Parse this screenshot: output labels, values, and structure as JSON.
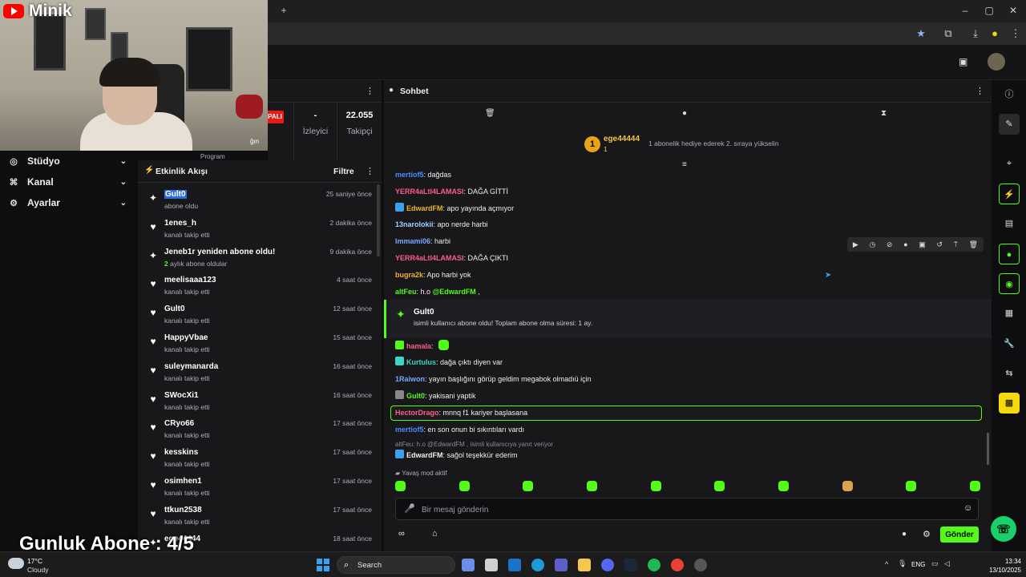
{
  "overlay": {
    "channel_name": "Minik",
    "daily_subs": "Gunluk Abone : 4/5"
  },
  "left_nav": {
    "items": [
      {
        "label": "Stüdyo",
        "icon": "studio-icon"
      },
      {
        "label": "Kanal",
        "icon": "channel-icon"
      },
      {
        "label": "Ayarlar",
        "icon": "gear-icon"
      }
    ]
  },
  "stats": {
    "live_badge": "PALI",
    "program_label": "Program",
    "viewers_value": "-",
    "viewers_label": "İzleyici",
    "followers_value": "22.055",
    "followers_label": "Takipçi",
    "partial_label": "ğın"
  },
  "activity": {
    "title": "Etkinlik Akışı",
    "filter_label": "Filtre",
    "items": [
      {
        "name": "Gult0",
        "sub": "abone oldu",
        "time": "25 saniye önce",
        "icon": "sparkle-icon",
        "highlight": true
      },
      {
        "name": "1enes_h",
        "sub": "kanalı takip etti",
        "time": "2 dakika önce",
        "icon": "heart-icon"
      },
      {
        "name": "Jeneb1r yeniden abone oldu!",
        "sub_prefix": "2",
        "sub": " aylık abone oldular",
        "time": "9 dakika önce",
        "icon": "sparkle-icon"
      },
      {
        "name": "meelisaaa123",
        "sub": "kanalı takip etti",
        "time": "4 saat önce",
        "icon": "heart-icon"
      },
      {
        "name": "Gult0",
        "sub": "kanalı takip etti",
        "time": "12 saat önce",
        "icon": "heart-icon"
      },
      {
        "name": "HappyVbae",
        "sub": "kanalı takip etti",
        "time": "15 saat önce",
        "icon": "heart-icon"
      },
      {
        "name": "suleymanarda",
        "sub": "kanalı takip etti",
        "time": "16 saat önce",
        "icon": "heart-icon"
      },
      {
        "name": "SWocXi1",
        "sub": "kanalı takip etti",
        "time": "16 saat önce",
        "icon": "heart-icon"
      },
      {
        "name": "CRyo66",
        "sub": "kanalı takip etti",
        "time": "17 saat önce",
        "icon": "heart-icon"
      },
      {
        "name": "kesskins",
        "sub": "kanalı takip etti",
        "time": "17 saat önce",
        "icon": "heart-icon"
      },
      {
        "name": "osimhen1",
        "sub": "kanalı takip etti",
        "time": "17 saat önce",
        "icon": "heart-icon"
      },
      {
        "name": "ttkun2538",
        "sub": "kanalı takip etti",
        "time": "17 saat önce",
        "icon": "heart-icon"
      },
      {
        "name": "ege44444",
        "sub": "",
        "time": "18 saat önce",
        "icon": "sparkle-icon"
      }
    ]
  },
  "chat": {
    "title": "Sohbet",
    "pinned": {
      "rank": "1",
      "name": "ege44444",
      "count": "1",
      "text": "1 abonelik hediye ederek 2. sıraya yükselin"
    },
    "messages": [
      {
        "user": "mertiof5",
        "color": "#4a8cff",
        "text": ": dağdas"
      },
      {
        "user": "YERR4aLtI4LAMASI",
        "color": "#ff5c8a",
        "text": ": DAĞA GİTTİ"
      },
      {
        "user": "EdwardFM",
        "color": "#f0b429",
        "text": ": apo yayında açmıyor",
        "badge": "#3aa0f0"
      },
      {
        "user": "13narolokii",
        "color": "#9bd3ff",
        "text": ": apo nerde harbi"
      },
      {
        "user": "Immami06",
        "color": "#7aa7ff",
        "text": ": harbi"
      },
      {
        "user": "YERR4aLtI4LAMASI",
        "color": "#ff5c8a",
        "text": ": DAĞA ÇIKTI"
      },
      {
        "user": "bugra2k",
        "color": "#f0b429",
        "text": ": Apo harbi yok"
      },
      {
        "user": "altFeu",
        "color": "#53fc18",
        "text": ": h.o ",
        "mention": "@EdwardFM",
        "after": " ,"
      }
    ],
    "sub_event": {
      "name": "Gult0",
      "text": "isimli kullanıcı abone oldu! Toplam abone olma süresi: 1 ay."
    },
    "messages2": [
      {
        "user": "hamala",
        "color": "#ff5c8a",
        "text": ":",
        "badge": "#53fc18"
      },
      {
        "user": "Kurtulus",
        "color": "#3ad6c9",
        "text": ": dağa çıktı diyen var",
        "badge": "#3ad6c9"
      },
      {
        "user": "1Raiwon",
        "color": "#7aa7ff",
        "text": ": yayın başlığını görüp geldim megabok olmadıü için"
      },
      {
        "user": "Gult0",
        "color": "#53fc18",
        "text": ": yakisani yaptik",
        "badge": "#888"
      },
      {
        "user": "HectorDrago",
        "color": "#ff5c8a",
        "text": ": mnnq f1 kariyer başlasana"
      },
      {
        "user": "mertiof5",
        "color": "#4a8cff",
        "text": ": en son onun bi sıkıntıları vardı"
      }
    ],
    "reply_hint": "altFeu: h.o @EdwardFM , isimli kullanıcıya yanıt veriyor",
    "reply_msg": {
      "user": "EdwardFM",
      "color": "#f0b429",
      "text": ": sağol teşekkür ederim"
    },
    "slow_mode": "Yavaş mod aktif",
    "input_placeholder": "Bir mesaj gönderin",
    "send_label": "Gönder"
  },
  "taskbar": {
    "temp": "17°C",
    "condition": "Cloudy",
    "search": "Search",
    "lang": "ENG",
    "time": "13:34",
    "date": "13/10/2025"
  },
  "colors": {
    "accent": "#53fc18",
    "bg": "#0e0e10",
    "panel": "#18181b"
  }
}
